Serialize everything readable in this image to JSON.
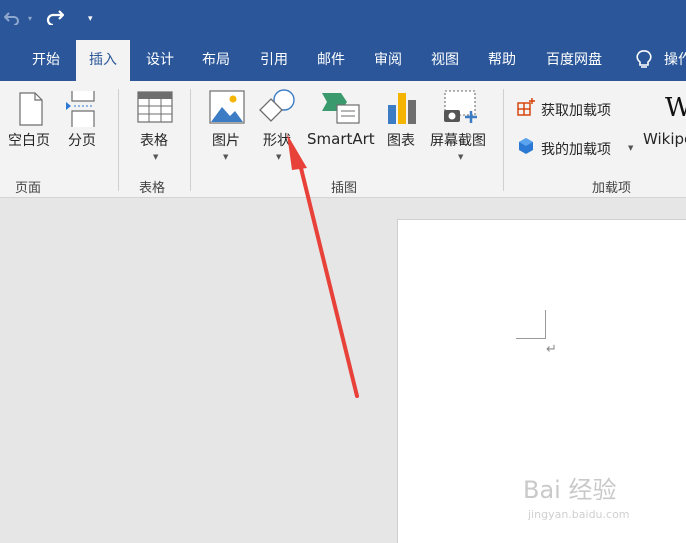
{
  "tabs": [
    {
      "label": "开始"
    },
    {
      "label": "插入"
    },
    {
      "label": "设计"
    },
    {
      "label": "布局"
    },
    {
      "label": "引用"
    },
    {
      "label": "邮件"
    },
    {
      "label": "审阅"
    },
    {
      "label": "视图"
    },
    {
      "label": "帮助"
    },
    {
      "label": "百度网盘"
    },
    {
      "label": "操作"
    }
  ],
  "active_tab": "插入",
  "ribbon": {
    "pages": {
      "blank_page": "空白页",
      "page_break": "分页",
      "group": "页面"
    },
    "tables": {
      "table": "表格",
      "group": "表格"
    },
    "illustrations": {
      "pictures": "图片",
      "shapes": "形状",
      "smartart": "SmartArt",
      "chart": "图表",
      "screenshot": "屏幕截图",
      "group": "插图"
    },
    "addins": {
      "get_addins": "获取加载项",
      "my_addins": "我的加载项",
      "wikipedia": "Wikipe",
      "group": "加载项"
    }
  },
  "document": {
    "paragraph_mark": "↵"
  },
  "watermark": {
    "text": "Bai 经验",
    "sub": "jingyan.baidu.com"
  },
  "colors": {
    "title_bar": "#2b579a",
    "ribbon": "#f3f3f3",
    "arrow": "#e8413a"
  }
}
